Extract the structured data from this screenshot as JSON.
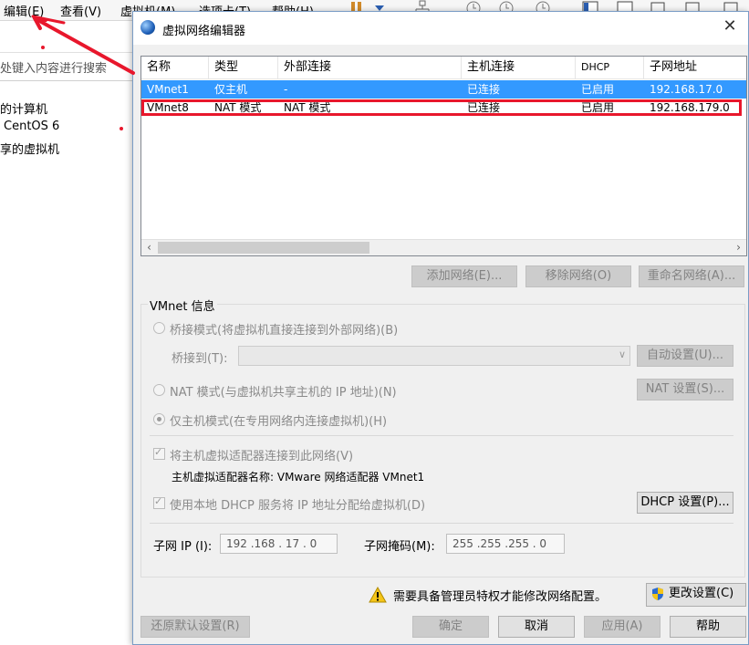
{
  "background": {
    "menus": [
      "编辑(E)",
      "查看(V)",
      "虚拟机(M)",
      "选项卡(T)",
      "帮助(H)"
    ],
    "search_placeholder": "处键入内容进行搜索",
    "tree": [
      "的计算机",
      "CentOS 6",
      "享的虚拟机"
    ]
  },
  "dialog": {
    "title": "虚拟网络编辑器",
    "columns": [
      "名称",
      "类型",
      "外部连接",
      "主机连接",
      "DHCP",
      "子网地址"
    ],
    "rows": [
      {
        "name": "VMnet1",
        "type": "仅主机",
        "external": "-",
        "host": "已连接",
        "dhcp": "已启用",
        "subnet": "192.168.17.0"
      },
      {
        "name": "VMnet8",
        "type": "NAT 模式",
        "external": "NAT 模式",
        "host": "已连接",
        "dhcp": "已启用",
        "subnet": "192.168.179.0"
      }
    ],
    "buttons": {
      "add": "添加网络(E)...",
      "remove": "移除网络(O)",
      "rename": "重命名网络(A)...",
      "auto": "自动设置(U)...",
      "nat_settings": "NAT 设置(S)...",
      "dhcp_settings": "DHCP 设置(P)...",
      "change_settings": "更改设置(C)",
      "restore": "还原默认设置(R)",
      "ok": "确定",
      "cancel": "取消",
      "apply": "应用(A)",
      "help": "帮助"
    },
    "vmnet_info": {
      "title": "VMnet 信息",
      "bridge_mode": "桥接模式(将虚拟机直接连接到外部网络)(B)",
      "bridge_to": "桥接到(T):",
      "nat_mode": "NAT 模式(与虚拟机共享主机的 IP 地址)(N)",
      "host_only": "仅主机模式(在专用网络内连接虚拟机)(H)",
      "connect_adapter": "将主机虚拟适配器连接到此网络(V)",
      "adapter_name": "主机虚拟适配器名称: VMware 网络适配器 VMnet1",
      "use_dhcp": "使用本地 DHCP 服务将 IP 地址分配给虚拟机(D)",
      "subnet_ip_label": "子网 IP (I):",
      "subnet_ip": "192 .168 . 17 . 0",
      "subnet_mask_label": "子网掩码(M):",
      "subnet_mask": "255 .255 .255 . 0"
    },
    "admin_warning": "需要具备管理员特权才能修改网络配置。"
  },
  "colors": {
    "selected_row": "#3399ff",
    "annotation_red": "#e8172c"
  }
}
